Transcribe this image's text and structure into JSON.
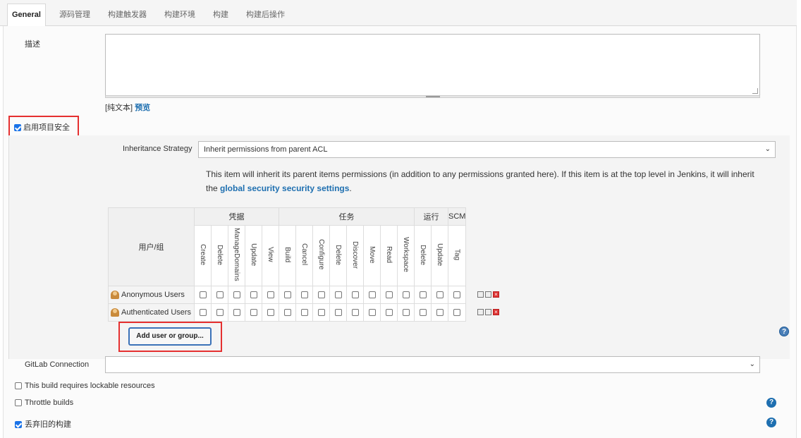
{
  "tabs": [
    "General",
    "源码管理",
    "构建触发器",
    "构建环境",
    "构建",
    "构建后操作"
  ],
  "description": {
    "label": "描述",
    "value": "",
    "plain_text": "[纯文本]",
    "preview": "预览"
  },
  "project_security": {
    "label": "启用项目安全",
    "checked": true
  },
  "inheritance": {
    "label": "Inheritance Strategy",
    "selected": "Inherit permissions from parent ACL",
    "info_prefix": "This item will inherit its parent items permissions (in addition to any permissions granted here). If this item is at the top level in Jenkins, it will inherit the ",
    "info_link": "global security security settings",
    "info_suffix": "."
  },
  "matrix": {
    "user_header": "用户/组",
    "groups": [
      {
        "name": "凭据",
        "permissions": [
          "Create",
          "Delete",
          "ManageDomains",
          "Update",
          "View"
        ]
      },
      {
        "name": "任务",
        "permissions": [
          "Build",
          "Cancel",
          "Configure",
          "Delete",
          "Discover",
          "Move",
          "Read",
          "Workspace"
        ]
      },
      {
        "name": "运行",
        "permissions": [
          "Delete",
          "Update"
        ]
      },
      {
        "name": "SCM",
        "permissions": [
          "Tag"
        ]
      }
    ],
    "rows": [
      {
        "name": "Anonymous Users"
      },
      {
        "name": "Authenticated Users"
      }
    ]
  },
  "add_button": "Add user or group...",
  "gitlab": {
    "label": "GitLab Connection",
    "selected": ""
  },
  "options": [
    {
      "label": "This build requires lockable resources",
      "checked": false
    },
    {
      "label": "Throttle builds",
      "checked": false
    },
    {
      "label": "丢弃旧的构建",
      "checked": true
    }
  ],
  "colors": {
    "accent": "#1e6fb0",
    "highlight": "#e53030",
    "checkbox": "#1a73e8"
  }
}
